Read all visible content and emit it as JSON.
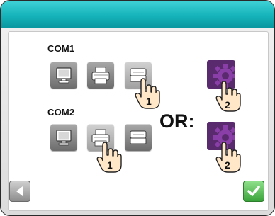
{
  "com1": {
    "label": "COM1"
  },
  "com2": {
    "label": "COM2"
  },
  "or_text": "OR:",
  "steps": {
    "step1": "1",
    "step2": "2"
  },
  "icons": {
    "monitor": "monitor-icon",
    "printer": "printer-icon",
    "scanner": "scanner-icon",
    "gear": "gear-icon",
    "hand": "hand-pointer-icon",
    "back": "back-arrow-icon",
    "ok": "checkmark-icon"
  },
  "colors": {
    "titlebar": "#16b4bb",
    "gear_bg": "#5a2a6e",
    "ok_button": "#3aa33a",
    "back_button": "#8d8d8d"
  }
}
